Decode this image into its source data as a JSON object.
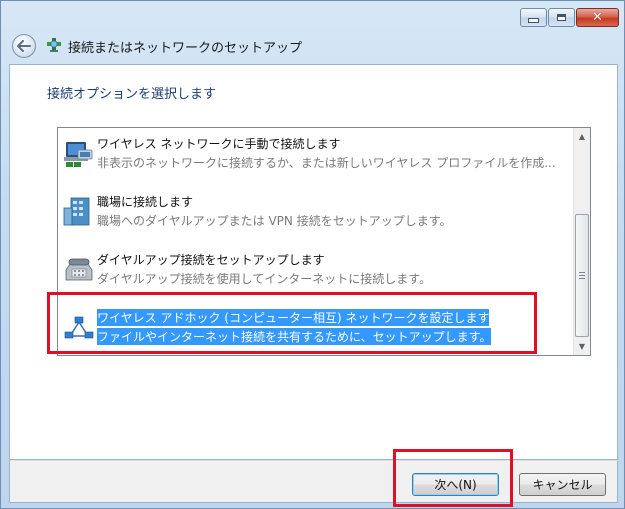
{
  "window": {
    "title": "接続またはネットワークのセットアップ",
    "close_glyph": "✕"
  },
  "page": {
    "prompt": "接続オプションを選択します"
  },
  "options": [
    {
      "title": "ワイヤレス ネットワークに手動で接続します",
      "description": "非表示のネットワークに接続するか、または新しいワイヤレス プロファイルを作成...",
      "icon": "wireless-network-computer-icon"
    },
    {
      "title": "職場に接続します",
      "description": "職場へのダイヤルアップまたは VPN 接続をセットアップします。",
      "icon": "workplace-building-icon"
    },
    {
      "title": "ダイヤルアップ接続をセットアップします",
      "description": "ダイヤルアップ接続を使用してインターネットに接続します。",
      "icon": "dialup-phone-icon"
    },
    {
      "title": "ワイヤレス アドホック (コンピューター相互) ネットワークを設定します",
      "description": "ファイルやインターネット接続を共有するために、セットアップします。",
      "icon": "adhoc-network-icon",
      "selected": true
    }
  ],
  "buttons": {
    "next": "次へ(N)",
    "cancel": "キャンセル"
  },
  "colors": {
    "selection": "#3399ff",
    "highlight_box": "#e01024",
    "prompt_text": "#1d3e74"
  }
}
